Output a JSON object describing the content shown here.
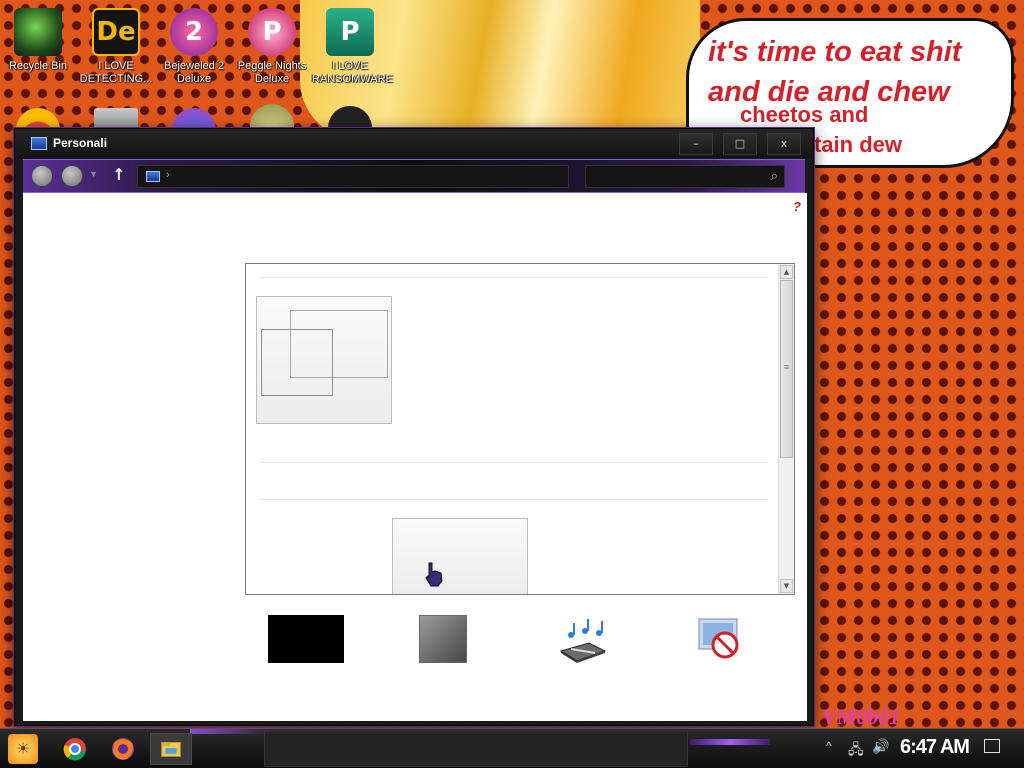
{
  "desktop": {
    "icons": [
      {
        "label": "Recycle Bin",
        "glyph": "",
        "icon": "recycle-bin-icon",
        "color": "#2a2a2a"
      },
      {
        "label": "I LOVE DETECTING...",
        "glyph": "De",
        "icon": "detect-it-easy-icon",
        "color": "#1a1a1a"
      },
      {
        "label": "Bejeweled 2 Deluxe",
        "glyph": "2",
        "icon": "bejeweled-icon",
        "color": "#c92a2a"
      },
      {
        "label": "Peggle Nights Deluxe",
        "glyph": "P",
        "icon": "peggle-icon",
        "color": "#d6336c"
      },
      {
        "label": "I LOVE RANSOMWARE",
        "glyph": "P",
        "icon": "publisher-icon",
        "color": "#1b8a6b"
      }
    ],
    "bubble_text": {
      "line1": "it's time to eat shit",
      "line2": "and die and chew",
      "line3": "cheetos and",
      "line4": "tain dew"
    },
    "watermark": "VM0b01"
  },
  "window": {
    "title": "Personali",
    "minimize_glyph": "–",
    "maximize_glyph": "□",
    "close_glyph": "x",
    "address_chevron": "›",
    "help_glyph": "?",
    "up_glyph": "↑",
    "search_glyph": "⌕",
    "scroll_up_glyph": "▲",
    "scroll_down_glyph": "▼",
    "scroll_grip_glyph": "≡"
  },
  "taskbar": {
    "start_glyph": "☀",
    "clock": "6:47 AM",
    "tray_chevron": "^",
    "network_glyph": "🖧",
    "volume_glyph": "🔊",
    "accent_color": "#8a4ccf"
  }
}
